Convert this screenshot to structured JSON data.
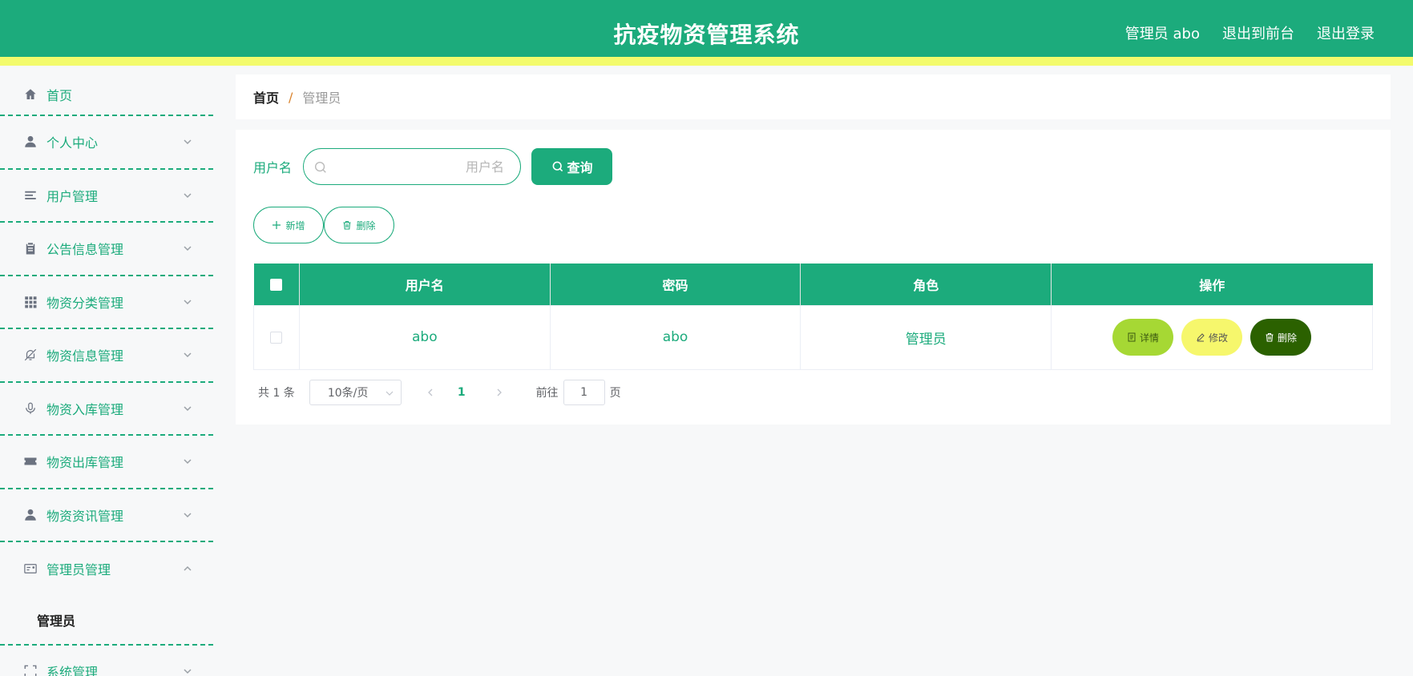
{
  "header": {
    "title": "抗疫物资管理系统",
    "user_label": "管理员 abo",
    "front_label": "退出到前台",
    "logout_label": "退出登录"
  },
  "sidebar": {
    "items": [
      {
        "label": "首页",
        "icon": "home-icon"
      },
      {
        "label": "个人中心",
        "icon": "user-icon"
      },
      {
        "label": "用户管理",
        "icon": "list-icon"
      },
      {
        "label": "公告信息管理",
        "icon": "clipboard-icon"
      },
      {
        "label": "物资分类管理",
        "icon": "grid-icon"
      },
      {
        "label": "物资信息管理",
        "icon": "bell-off-icon"
      },
      {
        "label": "物资入库管理",
        "icon": "microphone-icon"
      },
      {
        "label": "物资出库管理",
        "icon": "ticket-icon"
      },
      {
        "label": "物资资讯管理",
        "icon": "person-icon"
      },
      {
        "label": "管理员管理",
        "icon": "id-card-icon"
      },
      {
        "label": "系统管理",
        "icon": "fullscreen-icon"
      }
    ],
    "submenu_label": "管理员"
  },
  "breadcrumb": {
    "home": "首页",
    "separator": "/",
    "current": "管理员"
  },
  "search": {
    "label": "用户名",
    "placeholder": "用户名",
    "value": "",
    "button": "查询"
  },
  "actions": {
    "add": "新增",
    "delete": "删除"
  },
  "table": {
    "columns": [
      "用户名",
      "密码",
      "角色",
      "操作"
    ],
    "rows": [
      {
        "username": "abo",
        "password": "abo",
        "role": "管理员"
      }
    ],
    "ops": {
      "detail": "详情",
      "edit": "修改",
      "delete": "删除"
    }
  },
  "pagination": {
    "total": "共 1 条",
    "page_size": "10条/页",
    "current_page": "1",
    "goto_label": "前往",
    "goto_value": "1",
    "page_suffix": "页"
  },
  "colors": {
    "primary": "#1cab7c",
    "accent_bar": "#f3fb6c",
    "detail_btn": "#a6d834",
    "edit_btn": "#f6f76c",
    "delete_btn": "#2b6100"
  }
}
